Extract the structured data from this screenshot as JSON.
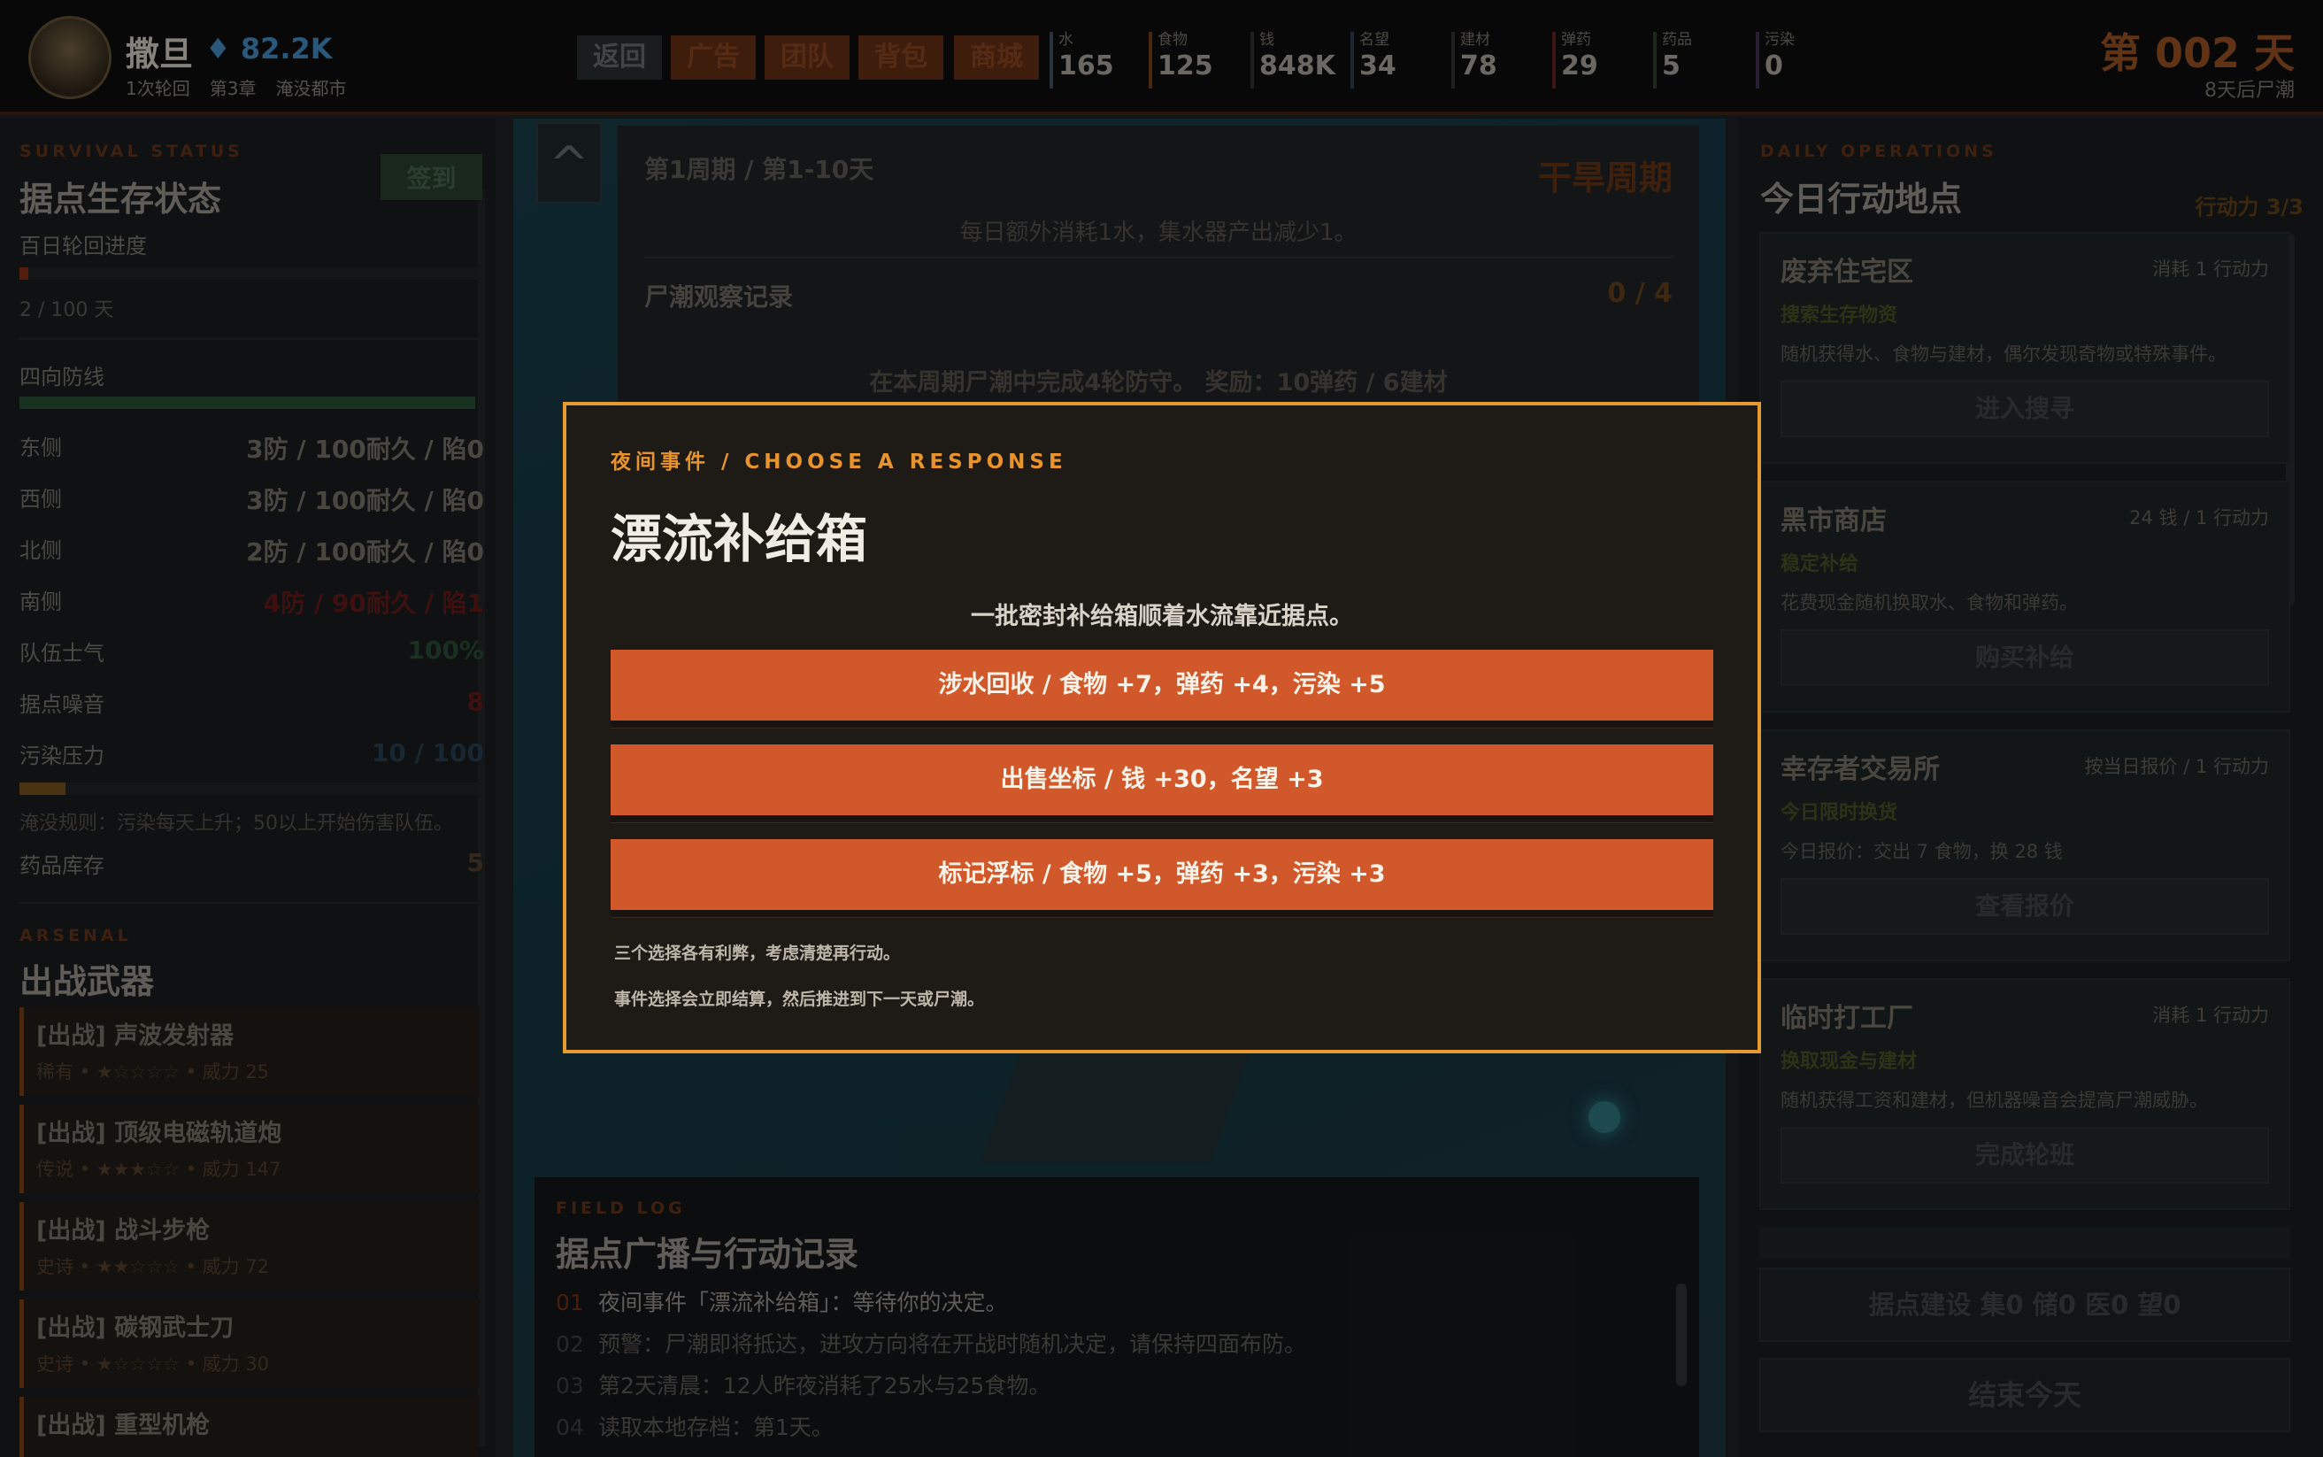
{
  "header": {
    "player_name": "撒旦",
    "gems": "82.2K",
    "cycle": "1次轮回",
    "chapter": "第3章",
    "location": "淹没都市",
    "nav": [
      "返回",
      "广告",
      "团队",
      "背包",
      "商城"
    ],
    "resources": [
      {
        "label": "水",
        "value": "165",
        "accent": "#3a4a5a"
      },
      {
        "label": "食物",
        "value": "125",
        "accent": "#6a3a18"
      },
      {
        "label": "钱",
        "value": "848K",
        "accent": "#2b2f32"
      },
      {
        "label": "名望",
        "value": "34",
        "accent": "#2b3a4a"
      },
      {
        "label": "建材",
        "value": "78",
        "accent": "#2b2f32"
      },
      {
        "label": "弹药",
        "value": "29",
        "accent": "#5a2020"
      },
      {
        "label": "药品",
        "value": "5",
        "accent": "#2b3a2b"
      },
      {
        "label": "污染",
        "value": "0",
        "accent": "#3a2a4a"
      }
    ],
    "day": "第 002 天",
    "day_sub": "8天后尸潮"
  },
  "left": {
    "eyebrow": "SURVIVAL STATUS",
    "title": "据点生存状态",
    "signin": "签到",
    "progress_label": "百日轮回进度",
    "progress_value": "2 / 100 天",
    "progress_fraction": 0.02,
    "defense_label": "四向防线",
    "defenses": [
      {
        "label": "东侧",
        "value": "3防 / 100耐久 / 陷0"
      },
      {
        "label": "西侧",
        "value": "3防 / 100耐久 / 陷0"
      },
      {
        "label": "北侧",
        "value": "2防 / 100耐久 / 陷0"
      },
      {
        "label": "南侧",
        "value": "4防 / 90耐久 / 陷1"
      }
    ],
    "morale_label": "队伍士气",
    "morale_value": "100%",
    "noise_label": "据点噪音",
    "noise_value": "8",
    "pollution_label": "污染压力",
    "pollution_value": "10 / 100",
    "pollution_fraction": 0.1,
    "rule": "淹没规则：污染每天上升；50以上开始伤害队伍。",
    "meds_label": "药品库存",
    "meds_value": "5",
    "arsenal_eyebrow": "ARSENAL",
    "arsenal_title": "出战武器",
    "weapons": [
      {
        "name": "[出战] 声波发射器",
        "rarity": "稀有",
        "stars": "★☆☆☆☆",
        "power": "威力 25"
      },
      {
        "name": "[出战] 顶级电磁轨道炮",
        "rarity": "传说",
        "stars": "★★★☆☆",
        "power": "威力 147"
      },
      {
        "name": "[出战] 战斗步枪",
        "rarity": "史诗",
        "stars": "★★☆☆☆",
        "power": "威力 72"
      },
      {
        "name": "[出战] 碳钢武士刀",
        "rarity": "史诗",
        "stars": "★☆☆☆☆",
        "power": "威力 30"
      },
      {
        "name": "[出战] 重型机枪"
      }
    ]
  },
  "middle": {
    "collapse": "^",
    "period": "第1周期 / 第1-10天",
    "period_type": "干旱周期",
    "period_desc": "每日额外消耗1水，集水器产出减少1。",
    "obs_label": "尸潮观察记录",
    "obs_value": "0 / 4",
    "obs_desc": "在本周期尸潮中完成4轮防守。 奖励：10弹药 / 6建材",
    "log_eyebrow": "FIELD LOG",
    "log_title": "据点广播与行动记录",
    "logs": [
      {
        "n": "01",
        "text": "夜间事件「漂流补给箱」：等待你的决定。"
      },
      {
        "n": "02",
        "text": "预警：尸潮即将抵达，进攻方向将在开战时随机决定，请保持四面布防。"
      },
      {
        "n": "03",
        "text": "第2天清晨：12人昨夜消耗了25水与25食物。"
      },
      {
        "n": "04",
        "text": "读取本地存档：第1天。"
      }
    ]
  },
  "right": {
    "eyebrow": "DAILY OPERATIONS",
    "title": "今日行动地点",
    "ap": "行动力 3/3",
    "locations": [
      {
        "name": "废弃住宅区",
        "cost": "消耗 1 行动力",
        "sub": "搜索生存物资",
        "desc": "随机获得水、食物与建材，偶尔发现奇物或特殊事件。",
        "btn": "进入搜寻"
      },
      {
        "name": "黑市商店",
        "cost": "24 钱 / 1 行动力",
        "sub": "稳定补给",
        "desc": "花费现金随机换取水、食物和弹药。",
        "btn": "购买补给"
      },
      {
        "name": "幸存者交易所",
        "cost": "按当日报价 / 1 行动力",
        "sub": "今日限时换货",
        "desc": "今日报价：交出 7 食物，换 28 钱",
        "btn": "查看报价"
      },
      {
        "name": "临时打工厂",
        "cost": "消耗 1 行动力",
        "sub": "换取现金与建材",
        "desc": "随机获得工资和建材，但机器噪音会提高尸潮威胁。",
        "btn": "完成轮班"
      }
    ],
    "build_btn": "据点建设 集0 储0 医0 望0",
    "end_btn": "结束今天"
  },
  "modal": {
    "kicker": "夜间事件 / CHOOSE A RESPONSE",
    "title": "漂流补给箱",
    "desc": "一批密封补给箱顺着水流靠近据点。",
    "options": [
      "涉水回收 / 食物 +7，弹药 +4，污染 +5",
      "出售坐标 / 钱 +30，名望 +3",
      "标记浮标 / 食物 +5，弹药 +3，污染 +3"
    ],
    "note1": "三个选择各有利弊，考虑清楚再行动。",
    "note2": "事件选择会立即结算，然后推进到下一天或尸潮。"
  }
}
